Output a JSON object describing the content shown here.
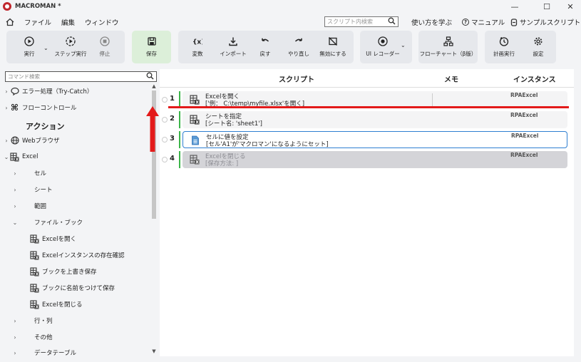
{
  "window": {
    "title": "MACROMAN *",
    "minimize": "—",
    "maximize": "☐",
    "close": "✕"
  },
  "menu": {
    "items": [
      "ファイル",
      "編集",
      "ウィンドウ"
    ]
  },
  "header": {
    "search_placeholder": "スクリプト内検索",
    "learn": "使い方を学ぶ",
    "manual": "マニュアル",
    "samples": "サンプルスクリプト"
  },
  "toolbar": {
    "run": "実行",
    "step_run": "ステップ実行",
    "stop": "停止",
    "save": "保存",
    "variables": "変数",
    "import": "インポート",
    "undo": "戻す",
    "redo": "やり直し",
    "disable": "無効にする",
    "ui_recorder": "UI レコーダー",
    "flowchart": "フローチャート（β版）",
    "schedule": "計画実行",
    "settings": "設定"
  },
  "left_panel": {
    "search_placeholder": "コマンド検索",
    "error_handling": "エラー処理（Try-Catch）",
    "flow_control": "フローコントロール",
    "actions_heading": "アクション",
    "web_browser": "Webブラウザ",
    "excel": "Excel",
    "cell": "セル",
    "sheet": "シート",
    "range": "範囲",
    "file_book": "ファイル・ブック",
    "open_excel": "Excelを開く",
    "check_instance": "Excelインスタンスの存在確認",
    "overwrite_save": "ブックを上書き保存",
    "save_as": "ブックに名前をつけて保存",
    "close_excel": "Excelを閉じる",
    "row_col": "行・列",
    "others": "その他",
    "data_table": "データテーブル"
  },
  "main": {
    "col_script": "スクリプト",
    "col_memo": "メモ",
    "col_instance": "インスタンス",
    "steps": [
      {
        "num": "1",
        "title": "Excelを開く",
        "detail": "['例： C:\\temp\\myfile.xlsx'を開く]",
        "instance": "RPAExcel"
      },
      {
        "num": "2",
        "title": "シートを指定",
        "detail": "[シート名: 'sheet1']",
        "instance": "RPAExcel"
      },
      {
        "num": "3",
        "title": "セルに値を設定",
        "detail": "[セル'A1'が'マクロマン'になるようにセット]",
        "instance": "RPAExcel"
      },
      {
        "num": "4",
        "title": "Excelを閉じる",
        "detail": "[保存方法: ]",
        "instance": "RPAExcel"
      }
    ]
  },
  "colors": {
    "accent_red": "#e31a1a",
    "selected_border": "#2f7fd1",
    "step_bar": "#3cb54a",
    "save_bg": "#dcefd9"
  }
}
